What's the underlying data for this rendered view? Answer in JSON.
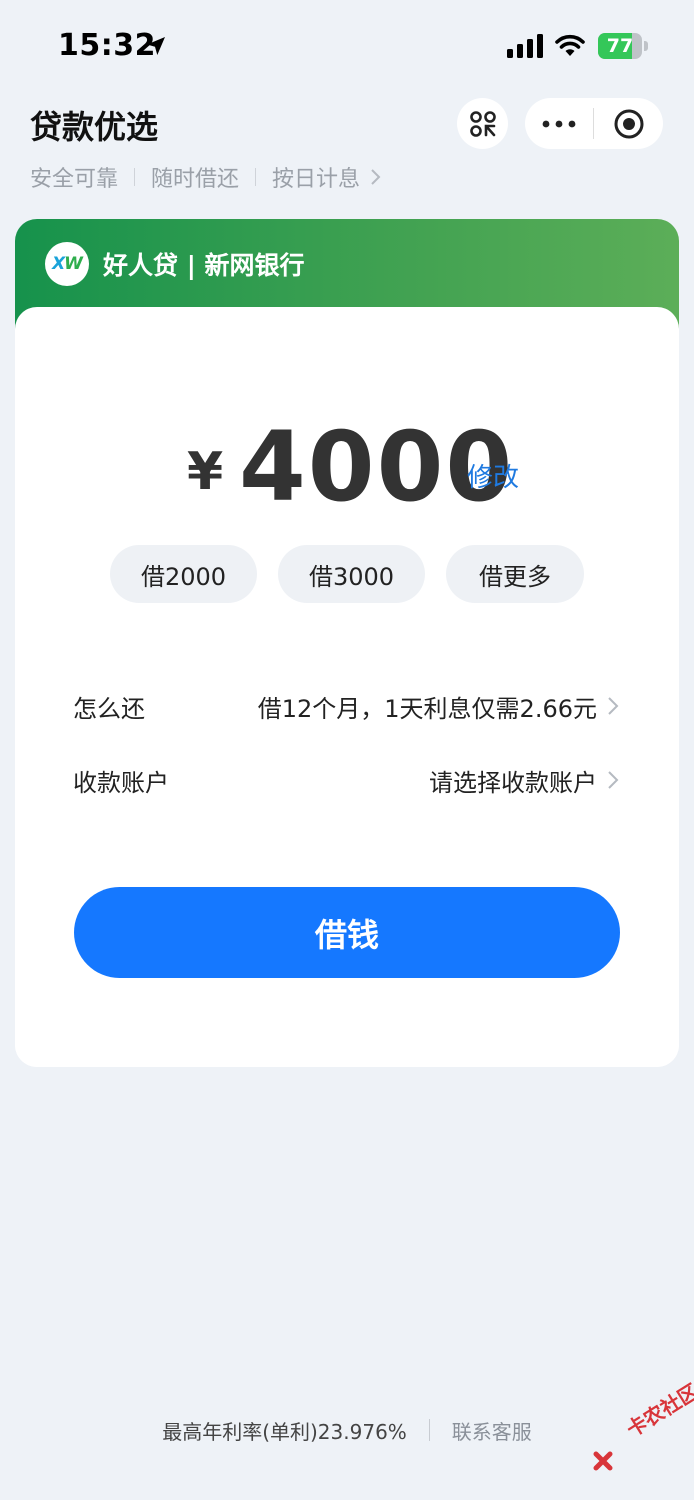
{
  "status_bar": {
    "time": "15:32",
    "battery": "77",
    "battery_level": 0.77
  },
  "header": {
    "title": "贷款优选",
    "tags": [
      "安全可靠",
      "随时借还",
      "按日计息"
    ]
  },
  "card": {
    "lender": "好人贷 | 新网银行",
    "logo_text": {
      "x": "X",
      "w": "W"
    },
    "currency_symbol": "¥",
    "amount": "4000",
    "edit_label": "修改",
    "chips": [
      "借2000",
      "借3000",
      "借更多"
    ],
    "repay_label": "怎么还",
    "repay_value": "借12个月，1天利息仅需2.66元",
    "account_label": "收款账户",
    "account_value": "请选择收款账户",
    "borrow_button": "借钱"
  },
  "footer": {
    "rate": "最高年利率(单利)23.976%",
    "service": "联系客服"
  },
  "watermark": "卡农社区",
  "colors": {
    "accent": "#1578ff",
    "header_green": "#3fa151",
    "background": "#eef2f7"
  }
}
